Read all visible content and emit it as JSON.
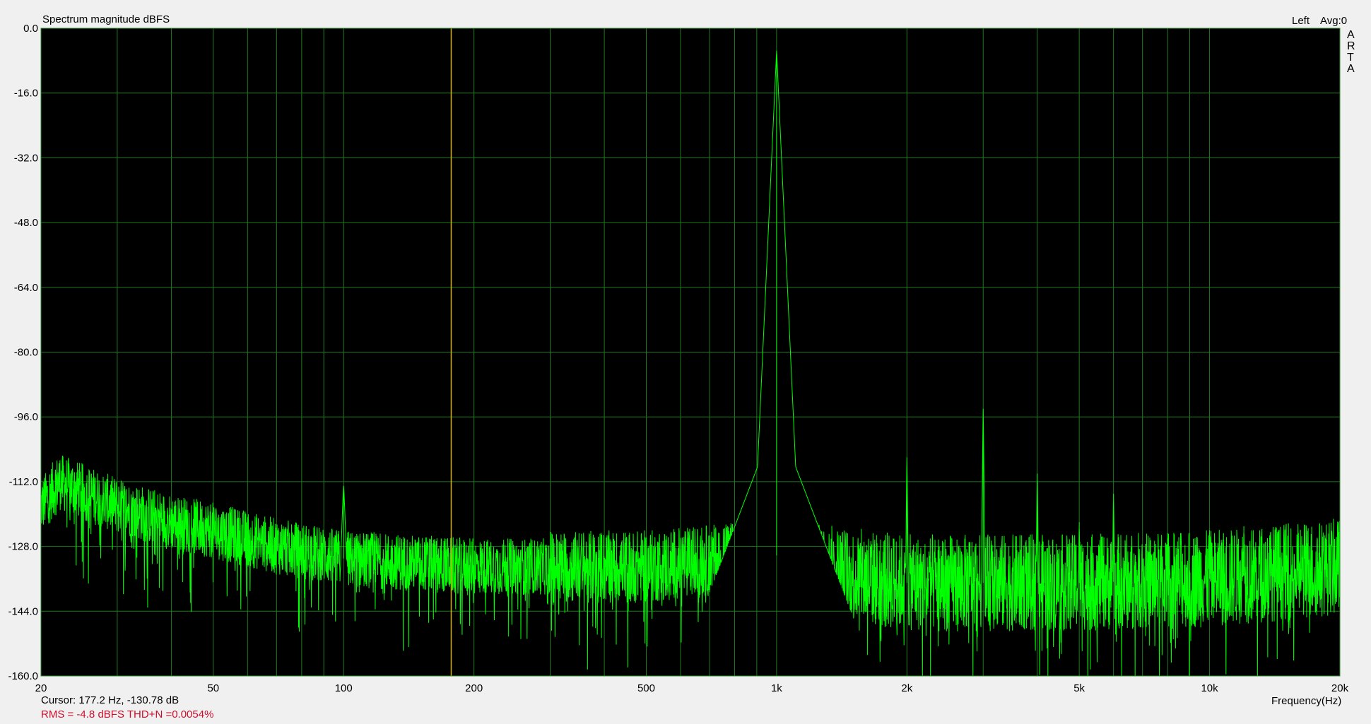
{
  "chart_data": {
    "type": "line",
    "title": "Spectrum magnitude dBFS",
    "channel_label": "Left",
    "avg_label": "Avg:0",
    "watermark": "ARTA",
    "xlabel": "Frequency(Hz)",
    "ylabel": "",
    "x_scale": "log",
    "xlim": [
      20,
      20000
    ],
    "ylim": [
      -160,
      0
    ],
    "y_ticks": [
      0,
      -16,
      -32,
      -48,
      -64,
      -80,
      -96,
      -112,
      -128,
      -144,
      -160
    ],
    "y_tick_labels": [
      "0.0",
      "-16.0",
      "-32.0",
      "-48.0",
      "-64.0",
      "-80.0",
      "-96.0",
      "-112.0",
      "-128.0",
      "-144.0",
      "-160.0"
    ],
    "x_ticks": [
      20,
      50,
      100,
      200,
      500,
      1000,
      2000,
      5000,
      10000,
      20000
    ],
    "x_tick_labels": [
      "20",
      "50",
      "100",
      "200",
      "500",
      "1k",
      "2k",
      "5k",
      "10k",
      "20k"
    ],
    "grid": true,
    "colors": {
      "plot_background": "#000000",
      "grid": "#1f7a1f",
      "trace": "#00ff00",
      "cursor": "#d4b000",
      "status_red": "#c8102e"
    },
    "cursor": {
      "freq_hz": 177.2,
      "level_db": -130.78,
      "readout": "Cursor:  177.2 Hz, -130.78 dB"
    },
    "stats": {
      "rms_text": "RMS =   -4.8 dBFS    THD+N =0.0054%"
    },
    "series": [
      {
        "fundamental": {
          "freq_hz": 1000,
          "peak_db": -5.5
        },
        "hum_peak": {
          "freq_hz": 100,
          "peak_db": -113
        },
        "harmonics": [
          {
            "freq_hz": 2000,
            "peak_db": -106
          },
          {
            "freq_hz": 3000,
            "peak_db": -94
          },
          {
            "freq_hz": 4000,
            "peak_db": -110
          },
          {
            "freq_hz": 5000,
            "peak_db": -122
          },
          {
            "freq_hz": 6000,
            "peak_db": -115
          },
          {
            "freq_hz": 8000,
            "peak_db": -126
          },
          {
            "freq_hz": 10000,
            "peak_db": -124
          },
          {
            "freq_hz": 12000,
            "peak_db": -123
          },
          {
            "freq_hz": 16000,
            "peak_db": -128
          },
          {
            "freq_hz": 20000,
            "peak_db": -131
          }
        ],
        "noise_floor_db": [
          [
            20,
            -118
          ],
          [
            22,
            -112
          ],
          [
            30,
            -118
          ],
          [
            40,
            -122
          ],
          [
            50,
            -124
          ],
          [
            70,
            -128
          ],
          [
            100,
            -131
          ],
          [
            200,
            -133
          ],
          [
            500,
            -133
          ],
          [
            800,
            -131
          ],
          [
            900,
            -128
          ],
          [
            1200,
            -134
          ],
          [
            2000,
            -137
          ],
          [
            5000,
            -137
          ],
          [
            10000,
            -136
          ],
          [
            20000,
            -133
          ]
        ]
      }
    ]
  }
}
